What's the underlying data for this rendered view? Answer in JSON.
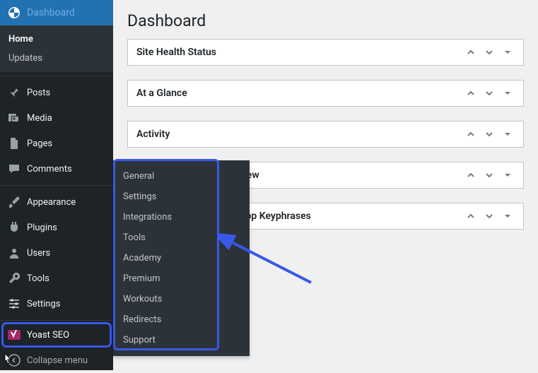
{
  "sidebar": {
    "dashboard": "Dashboard",
    "home": "Home",
    "updates": "Updates",
    "posts": "Posts",
    "media": "Media",
    "pages": "Pages",
    "comments": "Comments",
    "appearance": "Appearance",
    "plugins": "Plugins",
    "users": "Users",
    "tools": "Tools",
    "settings": "Settings",
    "yoast": "Yoast SEO",
    "collapse": "Collapse menu"
  },
  "flyout": {
    "items": [
      "General",
      "Settings",
      "Integrations",
      "Tools",
      "Academy",
      "Premium",
      "Workouts",
      "Redirects",
      "Support"
    ]
  },
  "page": {
    "title": "Dashboard"
  },
  "boxes": {
    "site_health": "Site Health Status",
    "glance": "At a Glance",
    "activity": "Activity",
    "yoast_overview": "rview",
    "yoast_top_keyphrases": ": Top Keyphrases"
  }
}
